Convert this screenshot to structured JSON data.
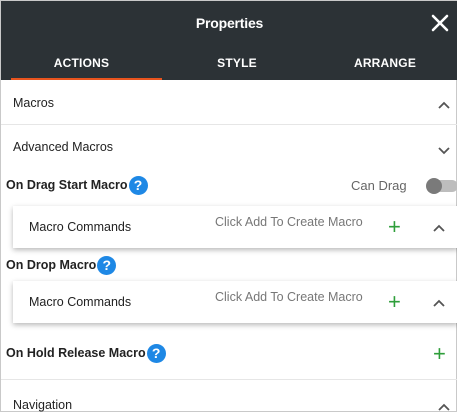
{
  "header": {
    "title": "Properties",
    "close_icon": "close-icon"
  },
  "tabs": [
    {
      "label": "ACTIONS",
      "active": true
    },
    {
      "label": "STYLE",
      "active": false
    },
    {
      "label": "ARRANGE",
      "active": false
    }
  ],
  "sections": {
    "macros": {
      "label": "Macros",
      "expanded": true
    },
    "advanced_macros": {
      "label": "Advanced Macros",
      "expanded": false
    },
    "navigation": {
      "label": "Navigation",
      "expanded": true
    }
  },
  "on_drag_start": {
    "title": "On Drag Start Macro",
    "help_icon": "?",
    "toggle_label": "Can Drag",
    "toggle_on": false,
    "card": {
      "label": "Macro Commands",
      "hint": "Click Add To Create Macro",
      "add_icon": "+"
    }
  },
  "on_drop": {
    "title": "On Drop Macro",
    "help_icon": "?",
    "card": {
      "label": "Macro Commands",
      "hint": "Click Add To Create Macro",
      "add_icon": "+"
    }
  },
  "on_hold_release": {
    "title": "On Hold Release Macro",
    "help_icon": "?",
    "add_icon": "+"
  },
  "colors": {
    "header_bg": "#2c3236",
    "accent": "#e8541e",
    "help": "#1e88e5",
    "add": "#2e9e3a"
  }
}
